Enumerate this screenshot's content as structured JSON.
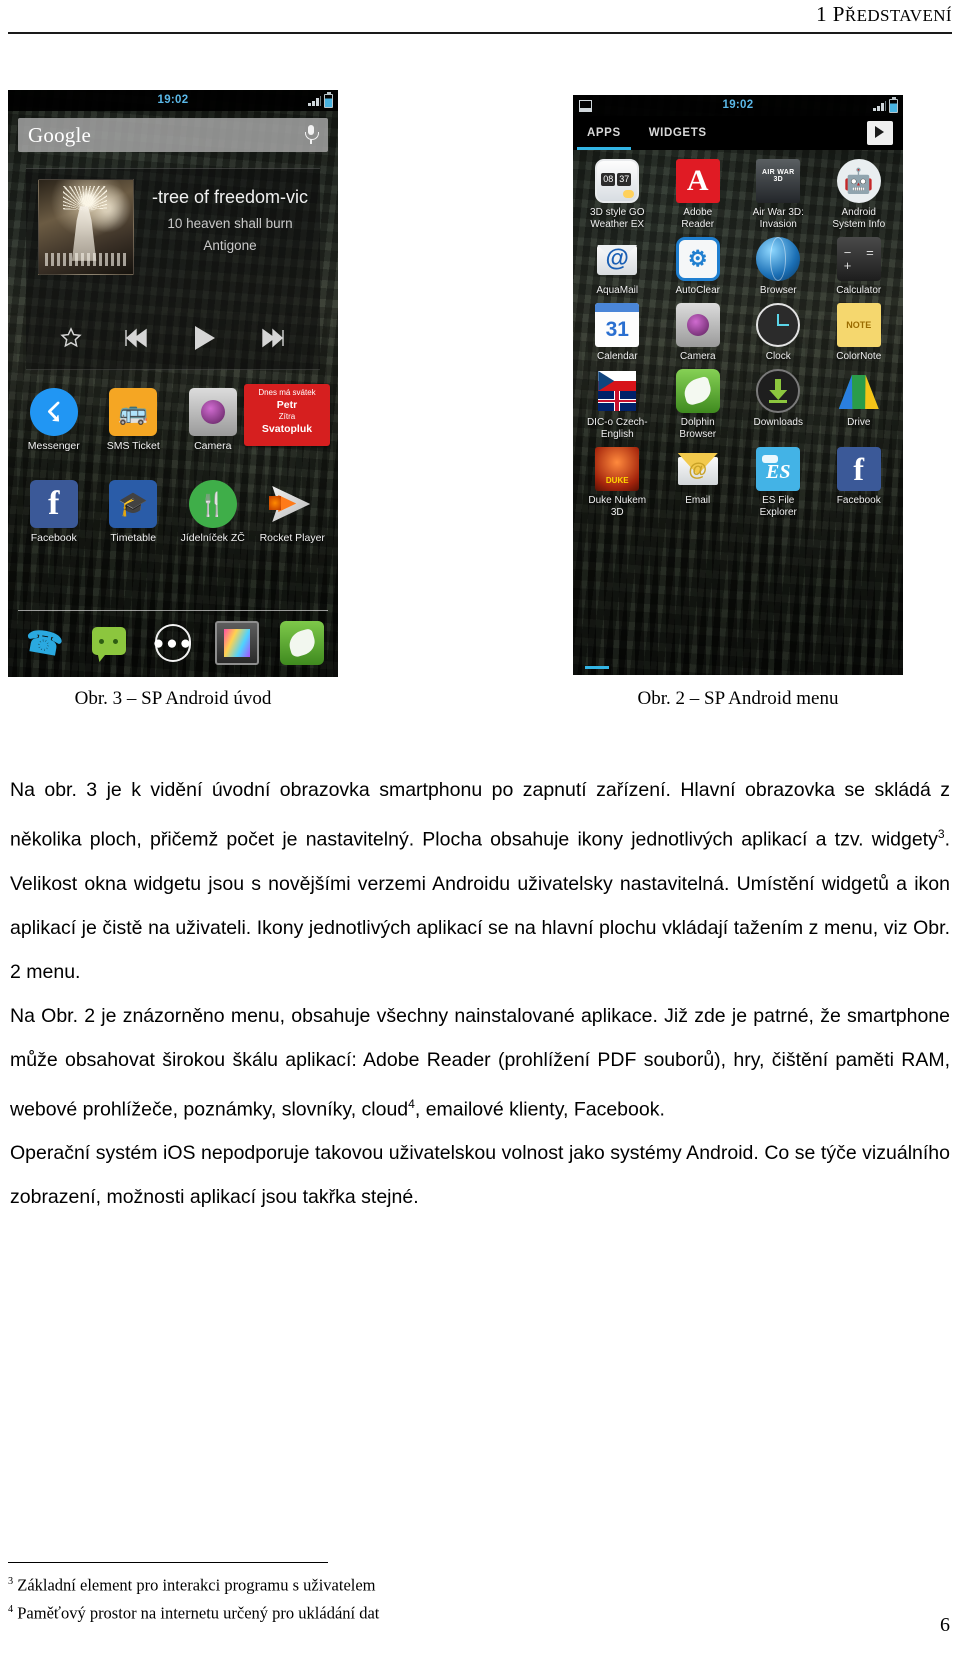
{
  "header": {
    "chapter_number": "1",
    "chapter_title": "PŘEDSTAVENÍ"
  },
  "figure_left": {
    "caption": "Obr. 3 – SP Android úvod",
    "status_bar": {
      "clock": "19:02"
    },
    "search_widget": {
      "label": "Google",
      "mic_icon": "microphone-icon"
    },
    "music_widget": {
      "title": "-tree of freedom-vic",
      "track": "10 heaven shall burn",
      "album": "Antigone",
      "controls": [
        "star-icon",
        "previous-icon",
        "play-icon",
        "next-icon"
      ]
    },
    "nameday_widget": {
      "line1": "Dnes má svátek",
      "line2": "Petr",
      "line3": "Zítra",
      "line4": "Svatopluk"
    },
    "apps_row1": [
      {
        "label": "Messenger",
        "icon": "messenger-icon"
      },
      {
        "label": "SMS Ticket",
        "icon": "bus-icon"
      },
      {
        "label": "Camera",
        "icon": "camera-icon"
      }
    ],
    "apps_row2": [
      {
        "label": "Facebook",
        "icon": "facebook-icon"
      },
      {
        "label": "Timetable",
        "icon": "graduation-cap-icon"
      },
      {
        "label": "Jídelníček ZČ",
        "icon": "cutlery-icon"
      },
      {
        "label": "Rocket Player",
        "icon": "rocket-player-icon"
      }
    ],
    "dock": [
      {
        "name": "phone-icon"
      },
      {
        "name": "messaging-icon"
      },
      {
        "name": "app-drawer-icon"
      },
      {
        "name": "gallery-icon"
      },
      {
        "name": "dolphin-browser-icon"
      }
    ]
  },
  "figure_right": {
    "caption": "Obr. 2 – SP Android menu",
    "status_bar": {
      "clock": "19:02",
      "left_icon": "screenshot-icon"
    },
    "tabs": [
      {
        "label": "APPS",
        "active": true
      },
      {
        "label": "WIDGETS",
        "active": false
      }
    ],
    "shop_button": "play-store-icon",
    "app_rows": [
      [
        {
          "label": "3D style GO\nWeather EX",
          "icon": "weather-clock-icon"
        },
        {
          "label": "Adobe\nReader",
          "icon": "adobe-reader-icon"
        },
        {
          "label": "Air War 3D:\nInvasion",
          "icon": "air-war-3d-icon"
        },
        {
          "label": "Android\nSystem Info",
          "icon": "android-system-info-icon"
        }
      ],
      [
        {
          "label": "AquaMail",
          "icon": "aquamail-icon"
        },
        {
          "label": "AutoClear",
          "icon": "autoclear-icon"
        },
        {
          "label": "Browser",
          "icon": "browser-globe-icon"
        },
        {
          "label": "Calculator",
          "icon": "calculator-icon"
        }
      ],
      [
        {
          "label": "Calendar",
          "icon": "calendar-icon",
          "badge": "31"
        },
        {
          "label": "Camera",
          "icon": "camera-icon"
        },
        {
          "label": "Clock",
          "icon": "clock-icon"
        },
        {
          "label": "ColorNote",
          "icon": "colornote-icon"
        }
      ],
      [
        {
          "label": "DIC-o Czech-\nEnglish",
          "icon": "dictionary-flags-icon"
        },
        {
          "label": "Dolphin\nBrowser",
          "icon": "dolphin-browser-icon"
        },
        {
          "label": "Downloads",
          "icon": "download-icon"
        },
        {
          "label": "Drive",
          "icon": "google-drive-icon"
        }
      ],
      [
        {
          "label": "Duke Nukem\n3D",
          "icon": "duke-nukem-icon"
        },
        {
          "label": "Email",
          "icon": "email-icon"
        },
        {
          "label": "ES File\nExplorer",
          "icon": "es-file-explorer-icon"
        },
        {
          "label": "Facebook",
          "icon": "facebook-icon"
        }
      ]
    ]
  },
  "body": {
    "paragraph1_a": "Na obr. 3 je k vidění úvodní obrazovka smartphonu po zapnutí zařízení. Hlavní obrazovka se skládá z několika ploch, přičemž počet je nastavitelný. Plocha obsahuje ikony jednotlivých aplikací a tzv. widgety",
    "paragraph1_fn": "3",
    "paragraph1_b": ". Velikost okna widgetu jsou s novějšími verzemi Androidu uživatelsky nastavitelná. Umístění widgetů a ikon aplikací je čistě na uživateli. Ikony jednotlivých aplikací se na hlavní plochu vkládají tažením z menu, viz Obr. 2 menu.",
    "paragraph2_a": "Na Obr. 2 je znázorněno menu, obsahuje všechny nainstalované aplikace. Již zde je patrné, že smartphone může obsahovat širokou škálu aplikací: Adobe Reader (prohlížení PDF souborů), hry, čištění paměti RAM, webové prohlížeče, poznámky, slovníky, cloud",
    "paragraph2_fn": "4",
    "paragraph2_b": ", emailové klienty, Facebook.",
    "paragraph3": "Operační systém iOS nepodporuje takovou uživatelskou volnost jako systémy Android. Co se týče vizuálního zobrazení, možnosti aplikací jsou takřka stejné."
  },
  "footnotes": [
    {
      "marker": "3",
      "text": "Základní element pro interakci programu s uživatelem"
    },
    {
      "marker": "4",
      "text": "Paměťový prostor na internetu určený pro ukládání dat"
    }
  ],
  "page_number": "6"
}
